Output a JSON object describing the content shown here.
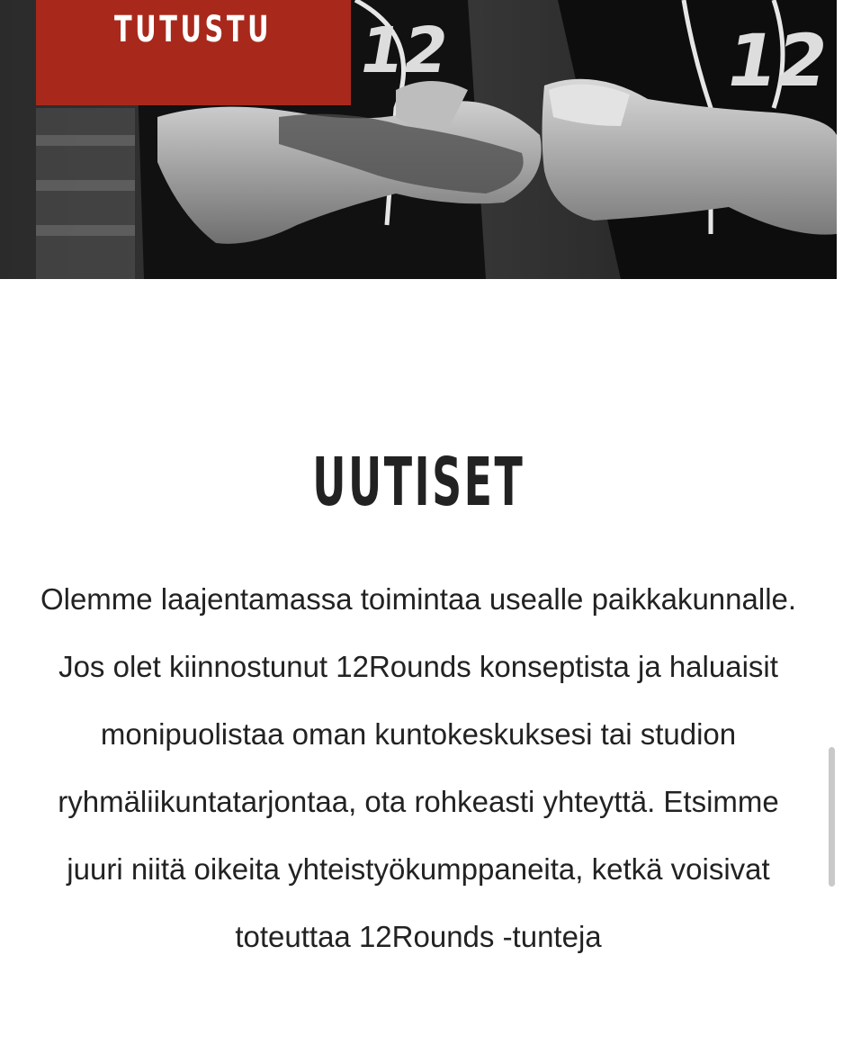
{
  "hero": {
    "image_name": "boxers-crossed-arms-photo",
    "cta_label": "TUTUSTU"
  },
  "news": {
    "title": "UUTISET",
    "body": "Olemme laajentamassa toimintaa usealle paikkakunnalle. Jos olet kiinnostunut 12Rounds konseptista ja haluaisit monipuolistaa oman kuntokeskuksesi tai studion ryhmäliikuntatarjontaa, ota rohkeasti yhteyttä. Etsimme juuri niitä oikeita yhteistyökumppaneita, ketkä voisivat toteuttaa 12Rounds -tunteja"
  },
  "colors": {
    "accent": "#a8291c",
    "text": "#222222",
    "background": "#ffffff"
  }
}
